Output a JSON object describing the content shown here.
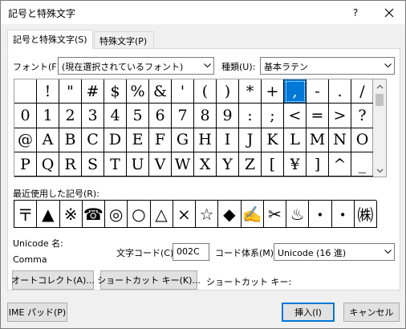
{
  "window": {
    "title": "記号と特殊文字",
    "help": "?"
  },
  "tabs": [
    {
      "label": "記号と特殊文字(S)"
    },
    {
      "label": "特殊文字(P)"
    }
  ],
  "font": {
    "label": "フォント(F):",
    "value": "(現在選択されているフォント)"
  },
  "subset": {
    "label": "種類(U):",
    "value": "基本ラテン"
  },
  "symbol_grid": {
    "rows": [
      [
        "",
        "!",
        "\"",
        "#",
        "$",
        "%",
        "&",
        "'",
        "(",
        ")",
        "*",
        "+",
        ",",
        "-",
        ".",
        "/"
      ],
      [
        "0",
        "1",
        "2",
        "3",
        "4",
        "5",
        "6",
        "7",
        "8",
        "9",
        ":",
        ";",
        "<",
        "=",
        ">",
        "?"
      ],
      [
        "@",
        "A",
        "B",
        "C",
        "D",
        "E",
        "F",
        "G",
        "H",
        "I",
        "J",
        "K",
        "L",
        "M",
        "N",
        "O"
      ],
      [
        "P",
        "Q",
        "R",
        "S",
        "T",
        "U",
        "V",
        "W",
        "X",
        "Y",
        "Z",
        "[",
        "¥",
        "]",
        "^",
        "_"
      ]
    ],
    "selected": ","
  },
  "recent": {
    "label": "最近使用した記号(R):",
    "symbols": [
      "〒",
      "▲",
      "※",
      "☎",
      "◎",
      "○",
      "△",
      "×",
      "☆",
      "◆",
      "✍",
      "✂",
      "♨",
      "・",
      "・",
      "㈱"
    ]
  },
  "unicode_name": {
    "label": "Unicode 名:",
    "value": "Comma"
  },
  "char_code": {
    "label": "文字コード(C):",
    "value": "002C"
  },
  "code_system": {
    "label": "コード体系(M):",
    "value": "Unicode (16 進)"
  },
  "buttons": {
    "autocorrect": "オートコレクト(A)...",
    "shortcut_key": "ショートカット キー(K)...",
    "shortcut_label": "ショートカット キー:",
    "ime_pad": "IME パッド(P)",
    "insert": "挿入(I)",
    "cancel": "キャンセル"
  }
}
